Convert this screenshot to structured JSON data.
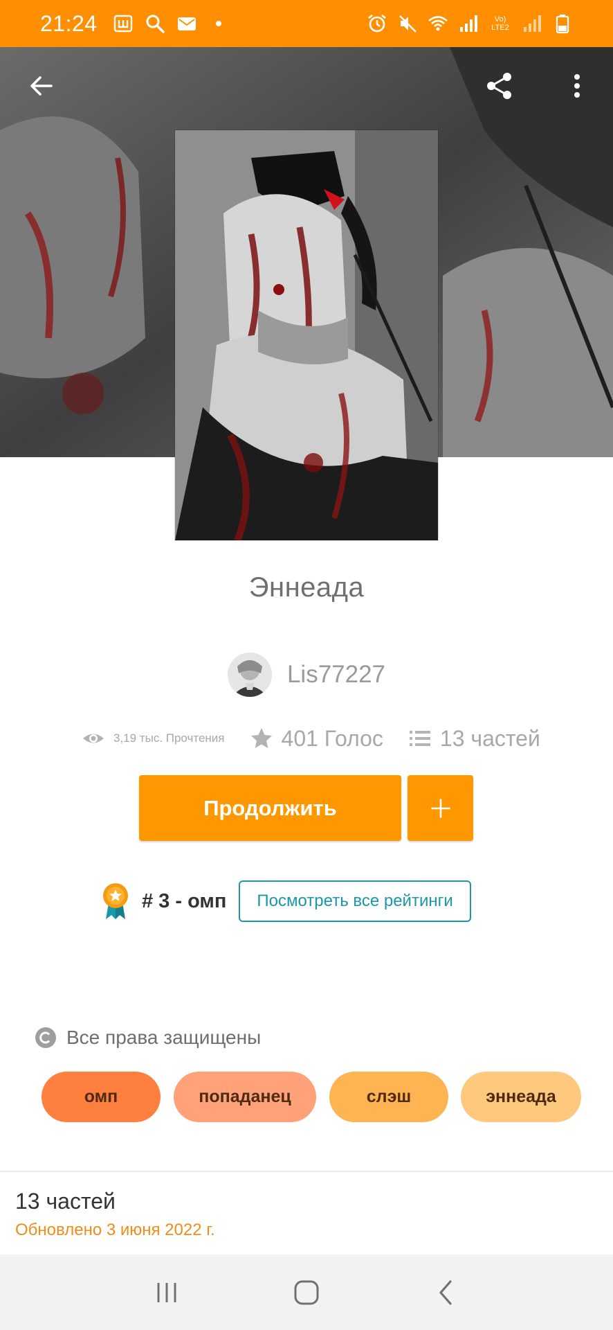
{
  "status_bar": {
    "time": "21:24",
    "network_label": "Vo) LTE2",
    "left_icons": [
      "wattpad-notification-icon",
      "search-notification-icon",
      "mail-notification-icon",
      "dot-icon"
    ],
    "right_icons": [
      "alarm-icon",
      "mute-icon",
      "wifi-icon",
      "signal-icon",
      "signal-icon-2",
      "battery-icon"
    ]
  },
  "header": {
    "back_icon": "arrow-left-icon",
    "share_icon": "share-icon",
    "more_icon": "more-vertical-icon"
  },
  "story": {
    "title": "Эннеада",
    "author": "Lis77227",
    "reads": "3,19 тыс. Прочтения",
    "votes": "401 Голос",
    "parts": "13 частей"
  },
  "actions": {
    "continue_label": "Продолжить",
    "add_label": "+"
  },
  "ranking": {
    "text": "# 3 - омп",
    "link_label": "Посмотреть все рейтинги"
  },
  "copyright": {
    "text": "Все права защищены"
  },
  "tags": [
    {
      "label": "омп",
      "color": "#ff7f3e"
    },
    {
      "label": "попаданец",
      "color": "#ffa27a"
    },
    {
      "label": "слэш",
      "color": "#ffb453"
    },
    {
      "label": "эннеада",
      "color": "#ffc97d"
    }
  ],
  "toc": {
    "parts_title": "13 частей",
    "updated": "Обновлено 3 июня 2022 г."
  },
  "colors": {
    "accent": "#ff9800",
    "status_bar": "#ff8f00",
    "teal": "#1a98a6"
  }
}
